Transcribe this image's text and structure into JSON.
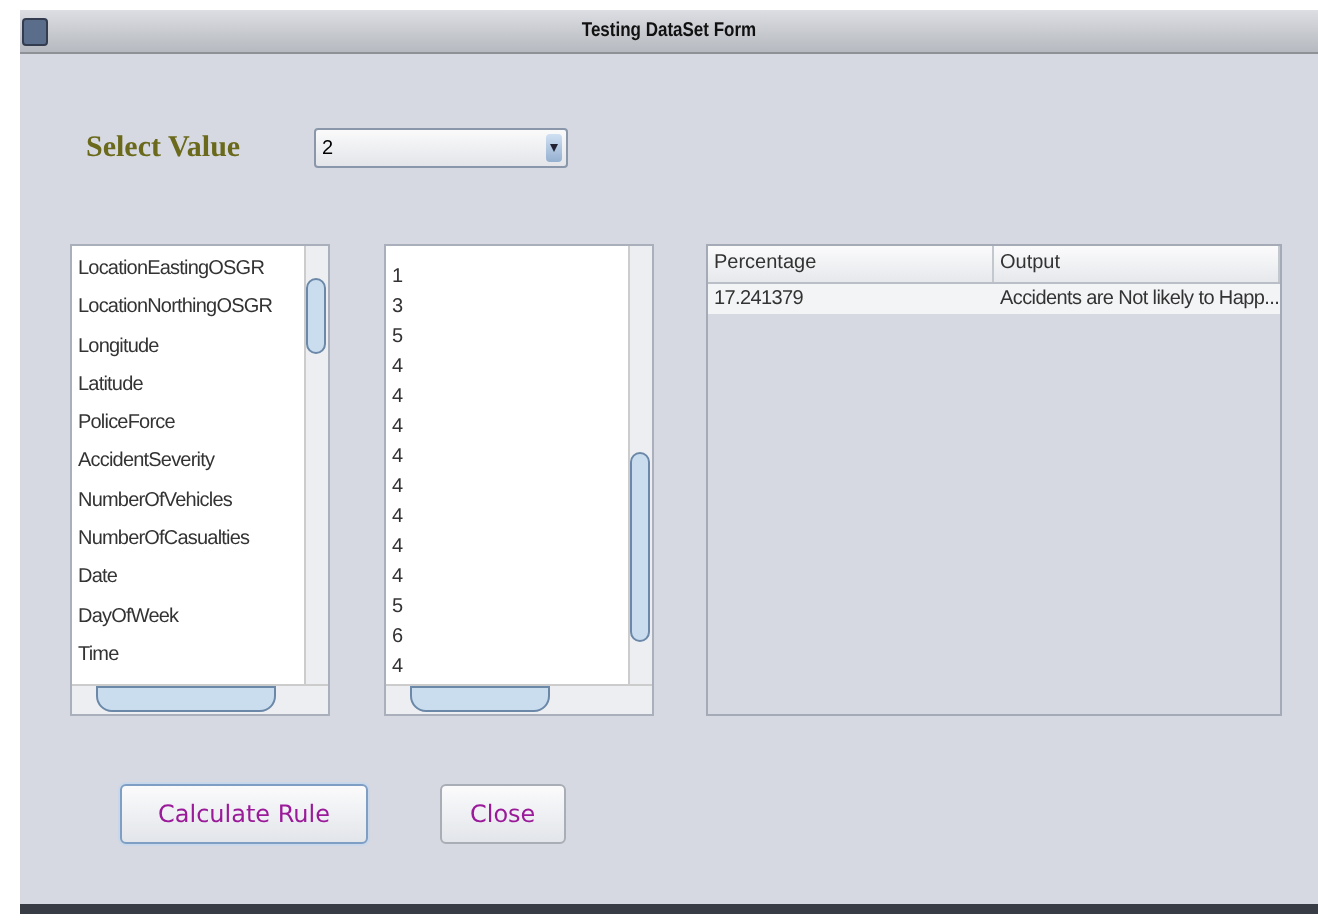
{
  "window": {
    "title": "Testing DataSet Form"
  },
  "select": {
    "label": "Select Value",
    "value": "2"
  },
  "attributes_list": {
    "items": [
      "LocationEastingOSGR",
      "LocationNorthingOSGR",
      "Longitude",
      "Latitude",
      "PoliceForce",
      "AccidentSeverity",
      "NumberOfVehicles",
      "NumberOfCasualties",
      "Date",
      "DayOfWeek",
      "Time"
    ]
  },
  "values_list": {
    "items": [
      "1",
      "3",
      "5",
      "4",
      "4",
      "4",
      "4",
      "4",
      "4",
      "4",
      "4",
      "5",
      "6",
      "4"
    ]
  },
  "table": {
    "columns": [
      "Percentage",
      "Output"
    ],
    "rows": [
      [
        "17.241379",
        "Accidents are Not likely to Happ..."
      ]
    ]
  },
  "buttons": [
    {
      "label": "Calculate Rule",
      "focused": true
    },
    {
      "label": "Close",
      "focused": false
    }
  ]
}
